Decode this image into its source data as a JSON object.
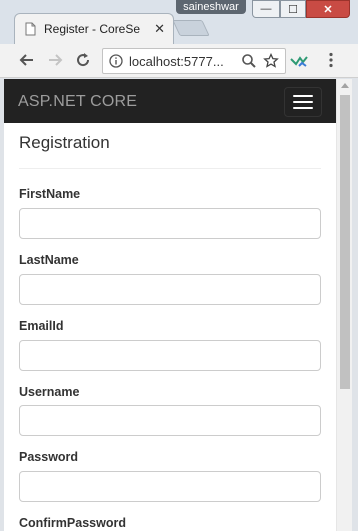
{
  "browser": {
    "tab_title": "Register - CoreSe",
    "tab_close": "✕",
    "user_badge": "saineshwar",
    "window_min": "—",
    "window_max": "☐",
    "window_close": "✕",
    "url": "localhost:5777..."
  },
  "navbar": {
    "brand": "ASP.NET CORE"
  },
  "page": {
    "title": "Registration"
  },
  "form": {
    "fields": [
      {
        "label": "FirstName"
      },
      {
        "label": "LastName"
      },
      {
        "label": "EmailId"
      },
      {
        "label": "Username"
      },
      {
        "label": "Password"
      },
      {
        "label": "ConfirmPassword"
      }
    ]
  }
}
